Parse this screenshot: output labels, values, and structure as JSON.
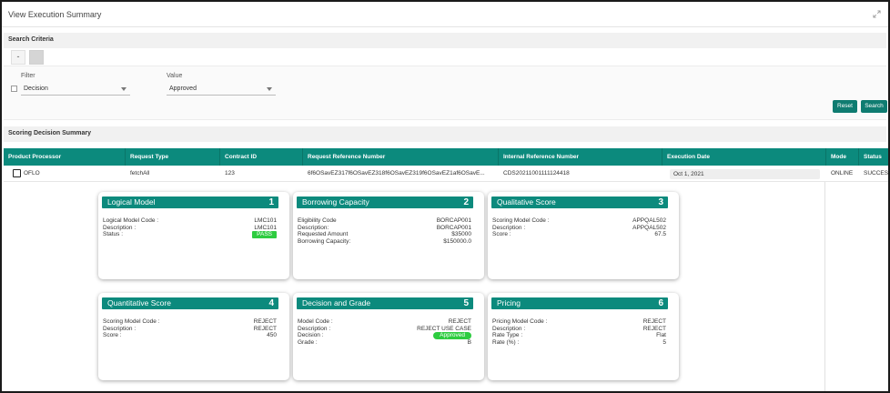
{
  "window": {
    "title": "View Execution Summary",
    "expand_icon": "expand-arrows-icon"
  },
  "search_criteria": {
    "header": "Search Criteria",
    "toggle_label": "-",
    "filter_label": "Filter",
    "filter_value": "Decision",
    "value_label": "Value",
    "value_value": "Approved",
    "reset_label": "Reset",
    "search_label": "Search"
  },
  "summary": {
    "header": "Scoring Decision Summary",
    "columns": [
      "Product Processor",
      "Request Type",
      "Contract ID",
      "Request Reference Number",
      "Internal Reference Number",
      "Execution Date",
      "Mode",
      "Status"
    ],
    "row": {
      "product_processor": "OFLO",
      "request_type": "fetchAll",
      "contract_id": "123",
      "request_reference": "6f6OSavEZ317f6OSavEZ318f6OSavEZ319f6OSavEZ1af6OSavE...",
      "internal_reference": "CDS20211001111124418",
      "execution_date": "Oct 1, 2021",
      "mode": "ONLINE",
      "status": "SUCCESS"
    }
  },
  "cards": [
    {
      "title": "Logical Model",
      "number": "1",
      "rows": [
        {
          "key": "Logical Model Code :",
          "value": "LMC101"
        },
        {
          "key": "Description :",
          "value": "LMC101"
        },
        {
          "key": "Status :",
          "value": "PASS",
          "badge": "pass"
        }
      ]
    },
    {
      "title": "Borrowing Capacity",
      "number": "2",
      "rows": [
        {
          "key": "Eligibility Code",
          "value": "BORCAP001"
        },
        {
          "key": "Description:",
          "value": "BORCAP001"
        },
        {
          "key": "Requested Amount",
          "value": "$35000"
        },
        {
          "key": "Borrowing Capacity:",
          "value": "$150000.0"
        }
      ]
    },
    {
      "title": "Qualitative Score",
      "number": "3",
      "rows": [
        {
          "key": "Scoring Model Code :",
          "value": "APPQAL502"
        },
        {
          "key": "Description :",
          "value": "APPQAL502"
        },
        {
          "key": "Score :",
          "value": "67.5"
        }
      ]
    },
    {
      "title": "Quantitative Score",
      "number": "4",
      "rows": [
        {
          "key": "Scoring Model Code :",
          "value": "REJECT"
        },
        {
          "key": "Description :",
          "value": "REJECT"
        },
        {
          "key": "Score :",
          "value": "450"
        }
      ]
    },
    {
      "title": "Decision and Grade",
      "number": "5",
      "rows": [
        {
          "key": "Model Code :",
          "value": "REJECT"
        },
        {
          "key": "Description :",
          "value": "REJECT USE CASE"
        },
        {
          "key": "Decision :",
          "value": "Approved",
          "badge": "approved"
        },
        {
          "key": "Grade :",
          "value": "B"
        }
      ]
    },
    {
      "title": "Pricing",
      "number": "6",
      "rows": [
        {
          "key": "Pricing Model Code :",
          "value": "REJECT"
        },
        {
          "key": "Description :",
          "value": "REJECT"
        },
        {
          "key": "Rate Type :",
          "value": "Flat"
        },
        {
          "key": "Rate (%) :",
          "value": "5"
        }
      ]
    }
  ],
  "colors": {
    "accent": "#0c8a7d",
    "button": "#0f7c71",
    "badge_green": "#2ecc40"
  }
}
